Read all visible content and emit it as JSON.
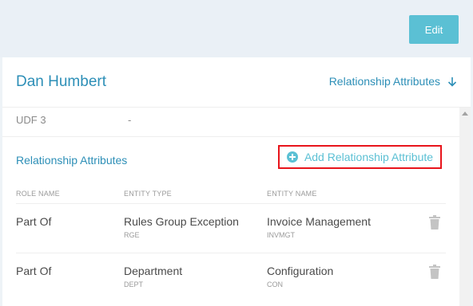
{
  "toolbar": {
    "edit_label": "Edit"
  },
  "header": {
    "name": "Dan Humbert",
    "link_label": "Relationship Attributes"
  },
  "udf": {
    "label": "UDF 3",
    "value": "-"
  },
  "relationships": {
    "title": "Relationship Attributes",
    "add_label": "Add Relationship Attribute",
    "columns": {
      "role": "ROLE NAME",
      "entity_type": "ENTITY TYPE",
      "entity_name": "ENTITY NAME"
    },
    "rows": [
      {
        "role": "Part Of",
        "entity_type": "Rules Group Exception",
        "entity_type_code": "RGE",
        "entity_name": "Invoice Management",
        "entity_name_code": "INVMGT"
      },
      {
        "role": "Part Of",
        "entity_type": "Department",
        "entity_type_code": "DEPT",
        "entity_name": "Configuration",
        "entity_name_code": "CON"
      }
    ]
  },
  "colors": {
    "accent": "#5bc0d4",
    "link": "#2d8fb7",
    "highlight": "#e8141b"
  },
  "icons": {
    "header_link": "arrow-down-icon",
    "add": "plus-circle-icon",
    "delete": "trash-icon"
  }
}
